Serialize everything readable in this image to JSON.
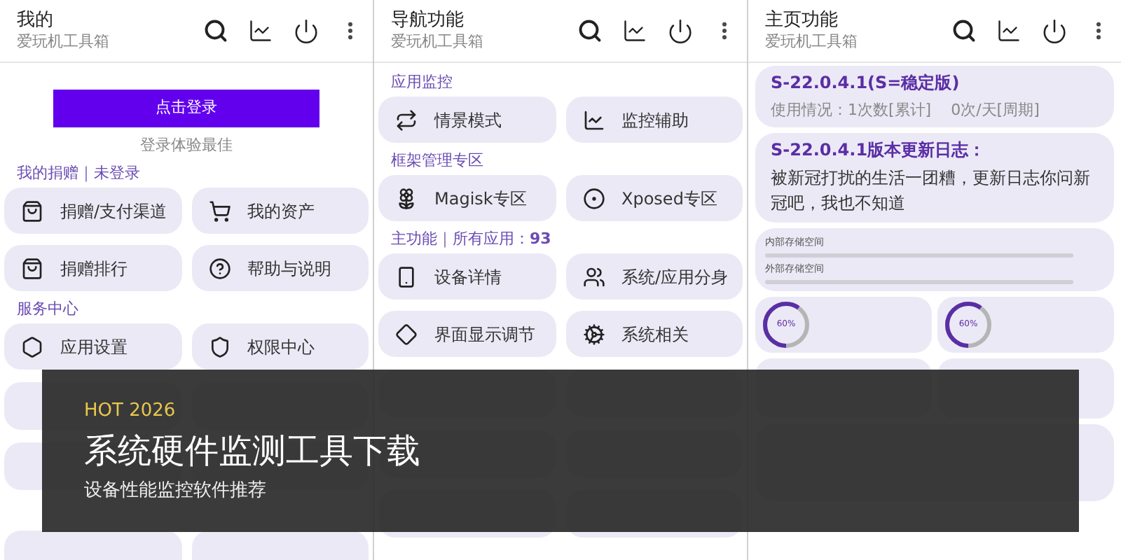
{
  "panels": [
    {
      "kind": "profile",
      "title": "我的",
      "subtitle": "爱玩机工具箱",
      "login_button": "点击登录",
      "login_hint": "登录体验最佳",
      "sections": [
        {
          "label": "我的捐赠｜未登录",
          "items": [
            "捐赠/支付渠道",
            "我的资产",
            "捐赠排行",
            "帮助与说明"
          ]
        },
        {
          "label": "服务中心",
          "items": [
            "应用设置",
            "权限中心"
          ]
        }
      ]
    },
    {
      "kind": "navigation",
      "title": "导航功能",
      "subtitle": "爱玩机工具箱",
      "sections": [
        {
          "label": "应用监控",
          "items": [
            "情景模式",
            "监控辅助"
          ]
        },
        {
          "label": "框架管理专区",
          "items": [
            "Magisk专区",
            "Xposed专区"
          ]
        },
        {
          "label": "主功能｜所有应用：**93**",
          "items": [
            "设备详情",
            "系统/应用分身",
            "界面显示调节",
            "系统相关"
          ]
        }
      ]
    },
    {
      "kind": "home",
      "title": "主页功能",
      "subtitle": "爱玩机工具箱",
      "version_card": {
        "title": "S-22.0.4.1(S=稳定版)",
        "usage_total": "使用情况：1次数[累计]",
        "usage_period": "0次/天[周期]"
      },
      "changelog_card": {
        "title": "S-22.0.4.1版本更新日志：",
        "text": "被新冠打扰的生活一团糟，更新日志你问新冠吧，我也不知道"
      },
      "storage": [
        {
          "label": "内部存储空间"
        },
        {
          "label": "外部存储空间"
        }
      ],
      "gauges": [
        {
          "reading": "60%",
          "level": 0.6
        },
        {
          "reading": "60%",
          "level": 0.6
        }
      ]
    }
  ],
  "banner": {
    "tag": "HOT 2026",
    "title": "系统硬件监测工具下载",
    "subtitle": "设备性能监控软件推荐"
  }
}
